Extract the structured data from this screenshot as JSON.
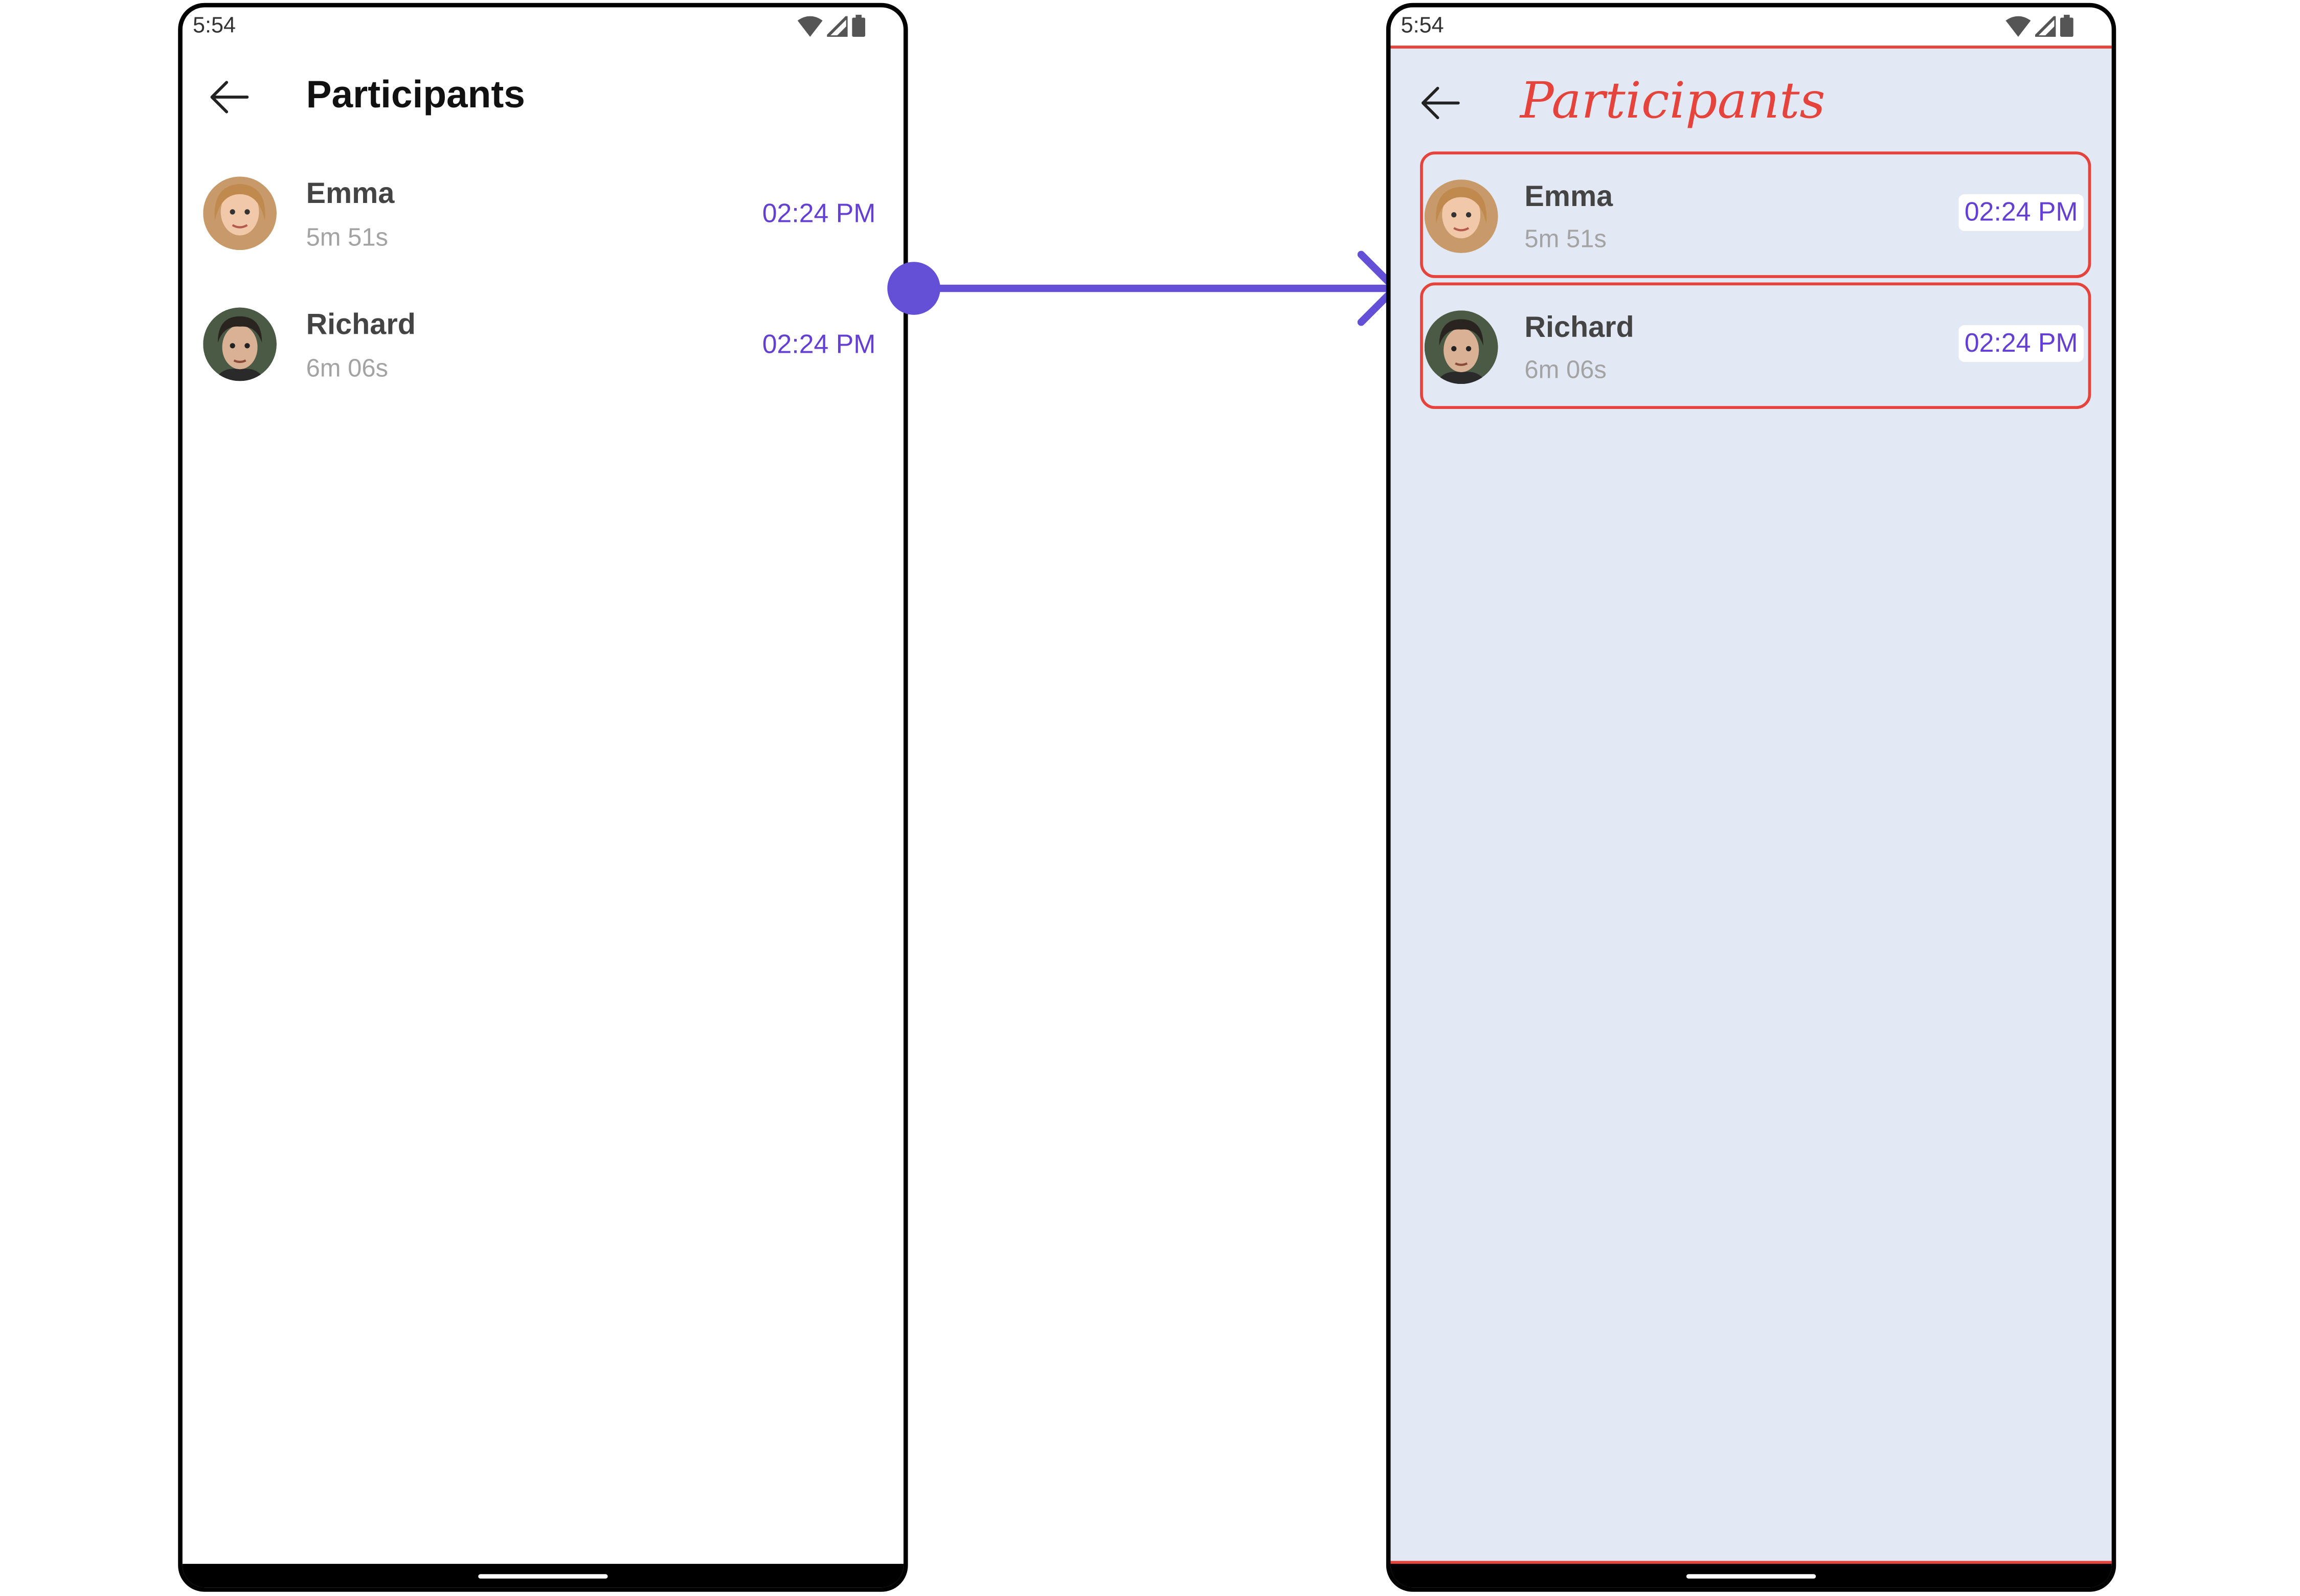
{
  "colors": {
    "accent": "#6340d2",
    "highlight_border": "#e5443c",
    "right_background": "#e3e9f4"
  },
  "left_screen": {
    "status_time": "5:54",
    "title": "Participants",
    "participants": [
      {
        "name": "Emma",
        "duration": "5m 51s",
        "time": "02:24 PM"
      },
      {
        "name": "Richard",
        "duration": "6m 06s",
        "time": "02:24 PM"
      }
    ]
  },
  "right_screen": {
    "status_time": "5:54",
    "title": "Participants",
    "participants": [
      {
        "name": "Emma",
        "duration": "5m 51s",
        "time": "02:24 PM"
      },
      {
        "name": "Richard",
        "duration": "6m 06s",
        "time": "02:24 PM"
      }
    ]
  },
  "icons": [
    "back-arrow-icon",
    "wifi-icon",
    "signal-icon",
    "battery-icon",
    "arrow-right-icon"
  ]
}
